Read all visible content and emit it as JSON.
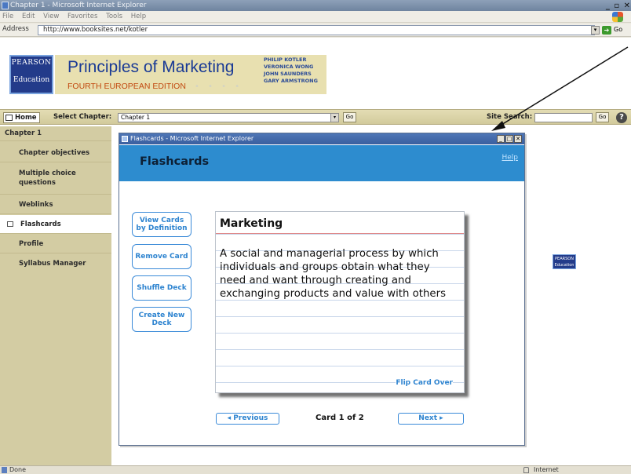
{
  "browser": {
    "title": "Chapter 1 - Microsoft Internet Explorer",
    "menu": [
      "File",
      "Edit",
      "View",
      "Favorites",
      "Tools",
      "Help"
    ],
    "address_label": "Address",
    "address_value": "http://www.booksites.net/kotler",
    "go_label": "Go",
    "status_text": "Done",
    "status_zone": "Internet"
  },
  "banner": {
    "logo_top": "PEARSON",
    "logo_bottom": "Education",
    "title": "Principles of Marketing",
    "edition": "FOURTH EUROPEAN EDITION",
    "authors": [
      "PHILIP KOTLER",
      "VERONICA WONG",
      "JOHN SAUNDERS",
      "GARY ARMSTRONG"
    ]
  },
  "chapter_bar": {
    "home_label": "Home",
    "select_label": "Select Chapter:",
    "selected_chapter": "Chapter 1",
    "go_label": "Go",
    "search_label": "Site Search:",
    "search_go_label": "Go",
    "help_glyph": "?"
  },
  "sidebar": {
    "chapter": "Chapter 1",
    "items": [
      "Chapter objectives",
      "Multiple choice questions",
      "Weblinks",
      "Flashcards",
      "Profile",
      "Syllabus Manager"
    ],
    "active_item": "Flashcards"
  },
  "small_logo": {
    "top": "PEARSON",
    "bottom": "Education"
  },
  "popup": {
    "title": "Flashcards - Microsoft Internet Explorer",
    "heading": "Flashcards",
    "help_link": "Help",
    "buttons": {
      "view_definition": "View Cards by Definition",
      "remove": "Remove Card",
      "shuffle": "Shuffle Deck",
      "create": "Create New Deck"
    },
    "card": {
      "term": "Marketing",
      "definition": "A social and managerial process by which individuals and groups obtain what they need and want through creating and exchanging products and value with others",
      "flip_label": "Flip Card Over"
    },
    "prev_label": "◂ Previous",
    "counter": "Card 1 of 2",
    "next_label": "Next ▸"
  },
  "colors": {
    "accent_blue": "#2e84d0",
    "header_blue": "#2d8ccf",
    "sidebar_bg": "#d3cca3",
    "brand_navy": "#1a3a95",
    "edition_orange": "#c24a11"
  }
}
